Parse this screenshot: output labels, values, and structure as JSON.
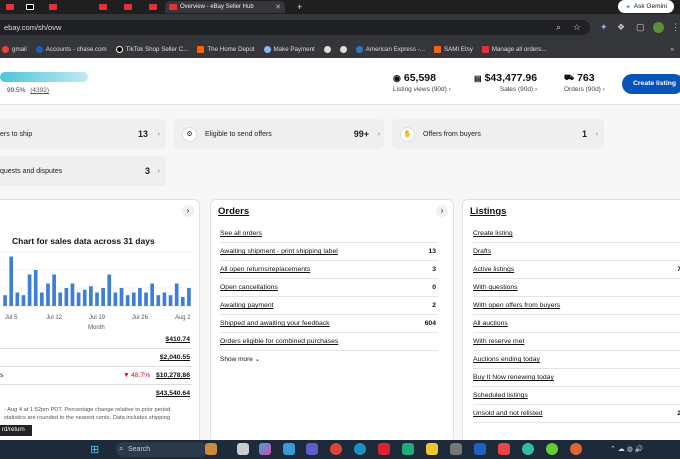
{
  "browser": {
    "active_tab_title": "Overview - eBay Seller Hub",
    "url": "ebay.com/sh/ovw",
    "gemini_label": "Ask Gemini",
    "bookmarks": [
      "gmail",
      "Accounts - chase.com",
      "TikTok Shop Seller C...",
      "The Home Depot",
      "Make Payment",
      "American Express -...",
      "SAMI Etsy",
      "Manage all orders..."
    ]
  },
  "header": {
    "seller_rating": "99.5%",
    "feedback_count": "(4392)",
    "listing_views": {
      "value": "65,598",
      "label": "Listing views (90d)"
    },
    "sales": {
      "value": "$43,477.96",
      "label": "Sales (90d)"
    },
    "orders": {
      "value": "763",
      "label": "Orders (90d)"
    },
    "create_listing": "Create listing"
  },
  "tasks": [
    {
      "label": "ers to ship",
      "count": "13"
    },
    {
      "label": "Eligible to send offers",
      "count": "99+"
    },
    {
      "label": "Offers from buyers",
      "count": "1"
    },
    {
      "label": "quests and disputes",
      "count": "3"
    }
  ],
  "sales_card": {
    "chart_title": "Chart for sales data across 31 days",
    "xlabel": "Month",
    "rows": [
      {
        "label": "",
        "amount": "$410.74"
      },
      {
        "label": "",
        "amount": "$2,040.55"
      },
      {
        "label": "s",
        "change": "48.7%",
        "amount": "$10,278.86"
      },
      {
        "label": "",
        "amount": "$43,540.64"
      }
    ],
    "footnote1": "- Aug 4 at 1:52pm PDT. Percentage change relative to prior period.",
    "footnote2": "statistics are rounded to the nearest cents. Data includes shipping",
    "tooltip": "rd/return"
  },
  "chart_data": {
    "type": "bar",
    "title": "Chart for sales data across 31 days",
    "xlabel": "Month",
    "x_ticks": [
      "Jul 5",
      "Jul 12",
      "Jul 19",
      "Jul 26",
      "Aug 2"
    ],
    "values": [
      1.2,
      5.5,
      1.5,
      1.2,
      3.5,
      4.0,
      1.5,
      2.5,
      3.5,
      1.5,
      2.0,
      2.5,
      1.5,
      1.8,
      2.2,
      1.5,
      2.0,
      3.5,
      1.5,
      2.0,
      1.2,
      1.5,
      2.0,
      1.5,
      2.5,
      1.2,
      1.5,
      1.2,
      2.5,
      1.0,
      2.0
    ],
    "grid": true
  },
  "orders_card": {
    "title": "Orders",
    "rows": [
      {
        "label": "See all orders",
        "count": ""
      },
      {
        "label": "Awaiting shipment - print shipping label",
        "count": "13"
      },
      {
        "label": "All open returns/replacements",
        "count": "3"
      },
      {
        "label": "Open cancellations",
        "count": "0"
      },
      {
        "label": "Awaiting payment",
        "count": "2"
      },
      {
        "label": "Shipped and awaiting your feedback",
        "count": "604"
      },
      {
        "label": "Orders eligible for combined purchases",
        "count": ""
      }
    ],
    "show_more": "Show more"
  },
  "listings_card": {
    "title": "Listings",
    "rows": [
      {
        "label": "Create listing",
        "count": ""
      },
      {
        "label": "Drafts",
        "count": ""
      },
      {
        "label": "Active listings",
        "count": "7"
      },
      {
        "label": "With questions",
        "count": ""
      },
      {
        "label": "With open offers from buyers",
        "count": ""
      },
      {
        "label": "All auctions",
        "count": ""
      },
      {
        "label": "With reserve met",
        "count": ""
      },
      {
        "label": "Auctions ending today",
        "count": ""
      },
      {
        "label": "Buy It Now renewing today",
        "count": ""
      },
      {
        "label": "Scheduled listings",
        "count": ""
      },
      {
        "label": "Unsold and not relisted",
        "count": "2"
      }
    ]
  },
  "taskbar": {
    "search": "Search"
  },
  "colors": {
    "accent": "#0654ba",
    "bar": "#3e7ed6",
    "negative": "#e0001b"
  }
}
